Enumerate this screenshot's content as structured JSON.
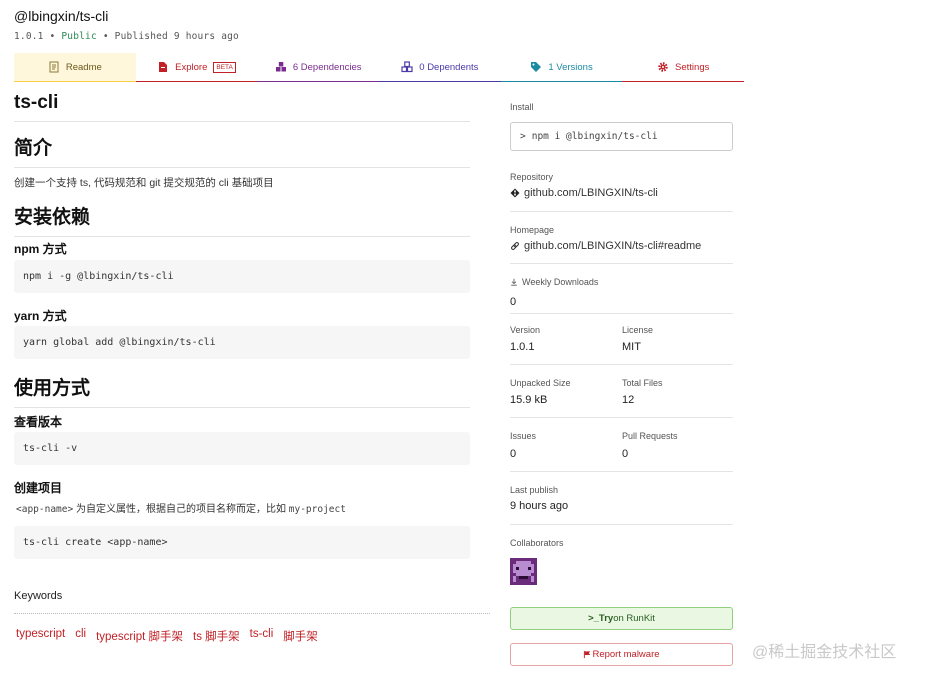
{
  "header": {
    "title": "@lbingxin/ts-cli",
    "version": "1.0.1",
    "sep1": "•",
    "visibility": "Public",
    "sep2": "•",
    "published": "Published 9 hours ago"
  },
  "tabs": [
    {
      "label": "Readme",
      "icon": "document-icon"
    },
    {
      "label": "Explore",
      "badge": "BETA",
      "icon": "file-icon"
    },
    {
      "label": "6 Dependencies",
      "icon": "cubes-icon"
    },
    {
      "label": "0 Dependents",
      "icon": "cubes-icon"
    },
    {
      "label": "1 Versions",
      "icon": "tag-icon"
    },
    {
      "label": "Settings",
      "icon": "gear-icon"
    }
  ],
  "readme": {
    "title": "ts-cli",
    "h_intro": "简介",
    "intro_text": "创建一个支持 ts, 代码规范和 git 提交规范的 cli 基础项目",
    "h_install": "安装依赖",
    "npm_heading": "npm 方式",
    "npm_code": "npm i -g @lbingxin/ts-cli",
    "yarn_heading": "yarn 方式",
    "yarn_code": "yarn global add @lbingxin/ts-cli",
    "h_usage": "使用方式",
    "version_heading": "查看版本",
    "version_code": "ts-cli -v",
    "create_heading": "创建项目",
    "create_code_inline": "<app-name>",
    "create_desc_mid": " 为自定义属性，根据自己的项目名称而定，比如 ",
    "create_example": "my-project",
    "create_code": "ts-cli create <app-name>"
  },
  "keywords": {
    "title": "Keywords",
    "items": [
      "typescript",
      "cli",
      "typescript 脚手架",
      "ts 脚手架",
      "ts-cli",
      "脚手架"
    ]
  },
  "sidebar": {
    "install_label": "Install",
    "install_prompt": ">",
    "install_cmd": "npm i @lbingxin/ts-cli",
    "repository_label": "Repository",
    "repository_value": "github.com/LBINGXIN/ts-cli",
    "homepage_label": "Homepage",
    "homepage_value": "github.com/LBINGXIN/ts-cli#readme",
    "weekly_label": "Weekly Downloads",
    "weekly_value": "0",
    "version_label": "Version",
    "version_value": "1.0.1",
    "license_label": "License",
    "license_value": "MIT",
    "unpacked_label": "Unpacked Size",
    "unpacked_value": "15.9 kB",
    "files_label": "Total Files",
    "files_value": "12",
    "issues_label": "Issues",
    "issues_value": "0",
    "pr_label": "Pull Requests",
    "pr_value": "0",
    "lastpub_label": "Last publish",
    "lastpub_value": "9 hours ago",
    "collab_label": "Collaborators",
    "runkit_prefix": ">_",
    "runkit_bold": "Try",
    "runkit_rest": " on RunKit",
    "report_icon": "flag-icon",
    "report_label": "Report malware"
  },
  "watermark": "@稀土掘金技术社区",
  "colors": {
    "accent_red": "#c12127",
    "readme_tab_bg": "#fff7dc",
    "runkit_bg": "#eaf7e3",
    "avatar_purple": "#6a2c7a"
  }
}
